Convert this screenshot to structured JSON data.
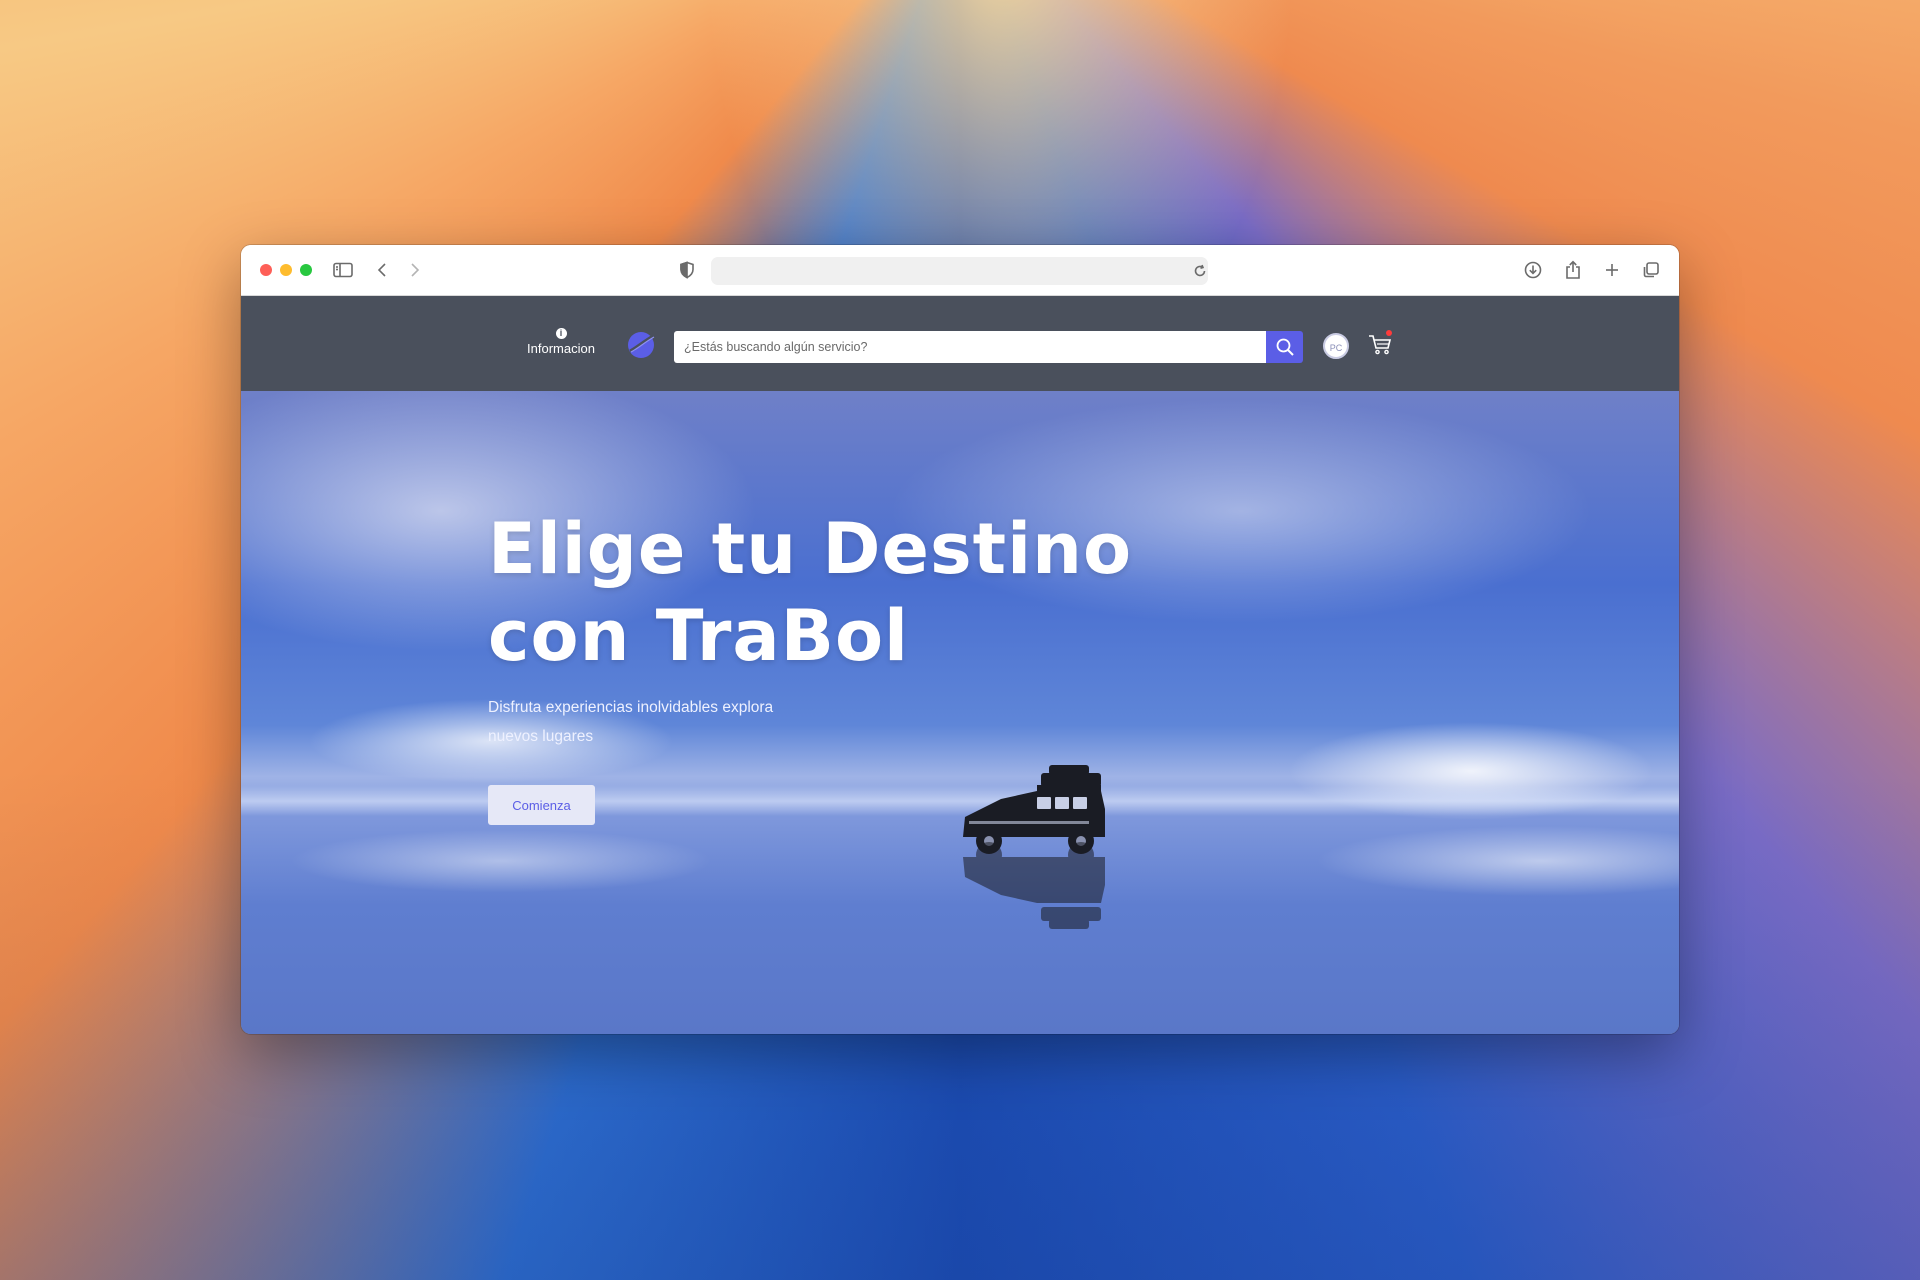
{
  "browser": {
    "address_value": ""
  },
  "navbar": {
    "info_label": "Informacion",
    "info_glyph": "i",
    "search_placeholder": "¿Estás buscando algún servicio?",
    "avatar_initials": "PC",
    "accent_color": "#5b5ee6",
    "cart_badge_color": "#ff3b3b"
  },
  "hero": {
    "title": "Elige tu Destino con TraBol",
    "subtitle": "Disfruta experiencias inolvidables explora nuevos lugares",
    "cta_label": "Comienza"
  },
  "icons": {
    "browser": [
      "sidebar-icon",
      "back-chevron-icon",
      "forward-chevron-icon",
      "shield-icon",
      "reload-icon",
      "download-icon",
      "share-icon",
      "new-tab-plus-icon",
      "tab-overview-icon"
    ],
    "page": [
      "info-icon",
      "logo-icon",
      "search-icon",
      "cart-icon"
    ]
  }
}
